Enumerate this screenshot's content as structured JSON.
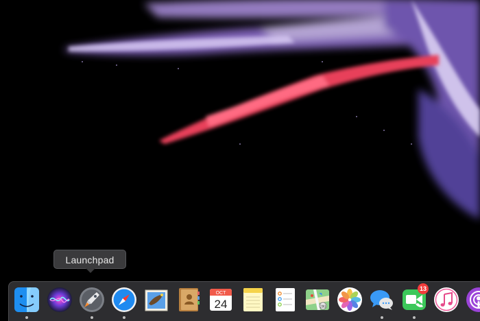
{
  "tooltip": {
    "label": "Launchpad"
  },
  "dock": {
    "items": [
      {
        "name": "Finder",
        "icon": "finder-icon",
        "running": true
      },
      {
        "name": "Siri",
        "icon": "siri-icon",
        "running": false
      },
      {
        "name": "Launchpad",
        "icon": "launchpad-icon",
        "running": true
      },
      {
        "name": "Safari",
        "icon": "safari-icon",
        "running": true
      },
      {
        "name": "Mail",
        "icon": "mail-icon",
        "running": false
      },
      {
        "name": "Contacts",
        "icon": "contacts-icon",
        "running": false
      },
      {
        "name": "Calendar",
        "icon": "calendar-icon",
        "running": false,
        "month": "OCT",
        "day": "24"
      },
      {
        "name": "Notes",
        "icon": "notes-icon",
        "running": false
      },
      {
        "name": "Reminders",
        "icon": "reminders-icon",
        "running": false
      },
      {
        "name": "Maps",
        "icon": "maps-icon",
        "running": false
      },
      {
        "name": "Photos",
        "icon": "photos-icon",
        "running": false
      },
      {
        "name": "Messages",
        "icon": "messages-icon",
        "running": true
      },
      {
        "name": "FaceTime",
        "icon": "facetime-icon",
        "running": true,
        "badge": "13"
      },
      {
        "name": "iTunes",
        "icon": "itunes-icon",
        "running": false
      },
      {
        "name": "Podcasts",
        "icon": "podcasts-icon",
        "running": false
      }
    ]
  },
  "colors": {
    "wallpaper": "#000000",
    "dock_background": "#3a3a3e",
    "badge": "#f23b3b",
    "smoke_purple": "#8a63c9",
    "smoke_pink": "#e2425f"
  }
}
